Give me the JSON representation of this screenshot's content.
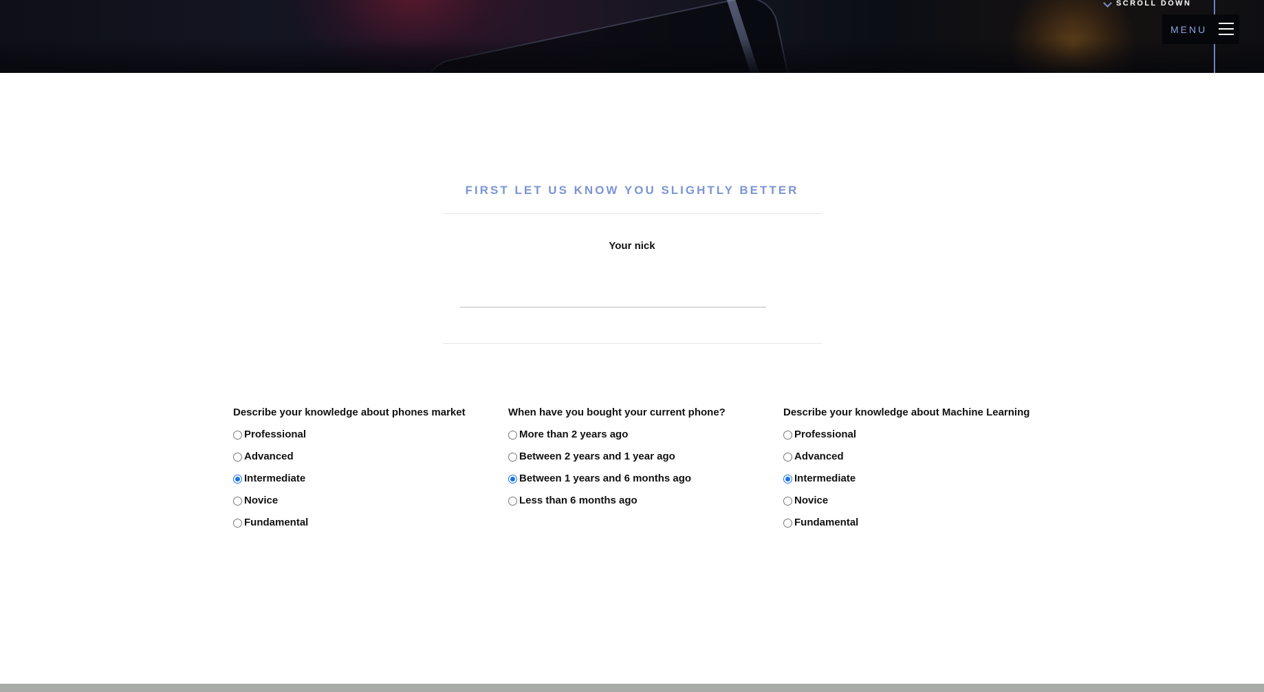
{
  "hero": {
    "scroll_label": "SCROLL DOWN",
    "menu_label": "MENU",
    "icons": [
      "chevron-down-icon",
      "hamburger-icon"
    ],
    "accent_color": "#7b94d4"
  },
  "intro": {
    "heading": "FIRST LET US KNOW YOU SLIGHTLY BETTER",
    "nick_label": "Your nick",
    "nick_value": ""
  },
  "questions": [
    {
      "title": "Describe your knowledge about phones market",
      "selected": "Intermediate",
      "options": [
        "Professional",
        "Advanced",
        "Intermediate",
        "Novice",
        "Fundamental"
      ]
    },
    {
      "title": "When have you bought your current phone?",
      "selected": "Between 1 years and 6 months ago",
      "options": [
        "More than 2 years ago",
        "Between 2 years and 1 year ago",
        "Between 1 years and 6 months ago",
        "Less than 6 months ago"
      ]
    },
    {
      "title": "Describe your knowledge about Machine Learning",
      "selected": "Intermediate",
      "options": [
        "Professional",
        "Advanced",
        "Intermediate",
        "Novice",
        "Fundamental"
      ]
    }
  ],
  "colors": {
    "radio_checked": "#1a73e8",
    "heading": "#7b94d4",
    "footer_bar": "#a9aba8"
  }
}
